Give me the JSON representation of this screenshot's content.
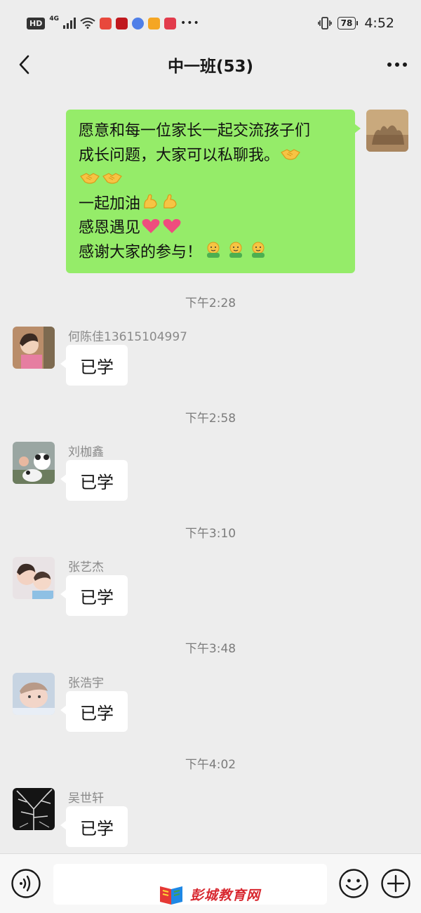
{
  "status_bar": {
    "hd": "HD",
    "network": "4G",
    "battery": "78",
    "time": "4:52"
  },
  "nav": {
    "title": "中一班(53)",
    "back_icon": "chevron-left-icon",
    "more_icon": "more-dots-icon"
  },
  "messages": {
    "self": {
      "lines": [
        "愿意和每一位家长一起交流孩子们",
        "成长问题，大家可以私聊我。",
        "",
        "一起加油",
        "感恩遇见",
        "感谢大家的参与！"
      ]
    },
    "items": [
      {
        "time": "下午2:28",
        "name": "何陈佳13615104997",
        "text": "已学"
      },
      {
        "time": "下午2:58",
        "name": "刘枷鑫",
        "text": "已学"
      },
      {
        "time": "下午3:10",
        "name": "张艺杰",
        "text": "已学"
      },
      {
        "time": "下午3:48",
        "name": "张浩宇",
        "text": "已学"
      },
      {
        "time": "下午4:02",
        "name": "吴世轩",
        "text": "已学"
      }
    ]
  },
  "input_bar": {
    "voice_icon": "voice-icon",
    "emoji_icon": "smiley-icon",
    "plus_icon": "plus-icon",
    "input_value": ""
  },
  "watermark": {
    "text": "彭城教育网"
  },
  "colors": {
    "background": "#ededed",
    "self_bubble": "#95ec69",
    "other_bubble": "#ffffff",
    "timestamp": "#7c7c7c"
  }
}
